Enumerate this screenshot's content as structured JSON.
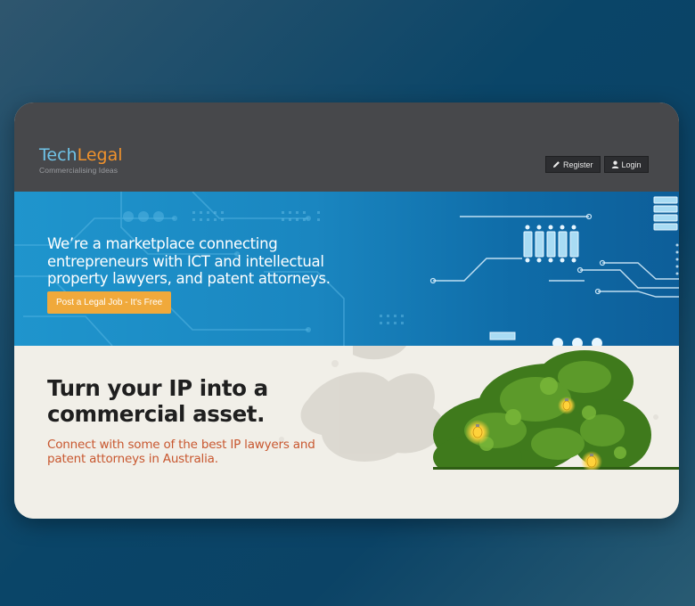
{
  "header": {
    "logo_part1": "Tech",
    "logo_part2": "Legal",
    "tagline": "Commercialising Ideas",
    "register_label": "Register",
    "login_label": "Login",
    "register_icon": "pencil-icon",
    "login_icon": "user-icon"
  },
  "hero": {
    "text": "We’re a marketplace connecting entrepreneurs with ICT and intellectual property lawyers, and patent attorneys.",
    "cta_label": "Post a Legal Job - It's Free"
  },
  "promo": {
    "headline": "Turn your IP into a commercial asset.",
    "subline": "Connect with some of the best IP lawyers and patent attorneys in Australia."
  },
  "colors": {
    "header_bg": "#47484b",
    "logo_tech": "#6fc3e8",
    "logo_legal": "#f0922c",
    "hero_blue": "#1a86c0",
    "cta_orange": "#f0a93b",
    "subline_orange": "#c8572f",
    "promo_bg": "#f1efe8"
  }
}
